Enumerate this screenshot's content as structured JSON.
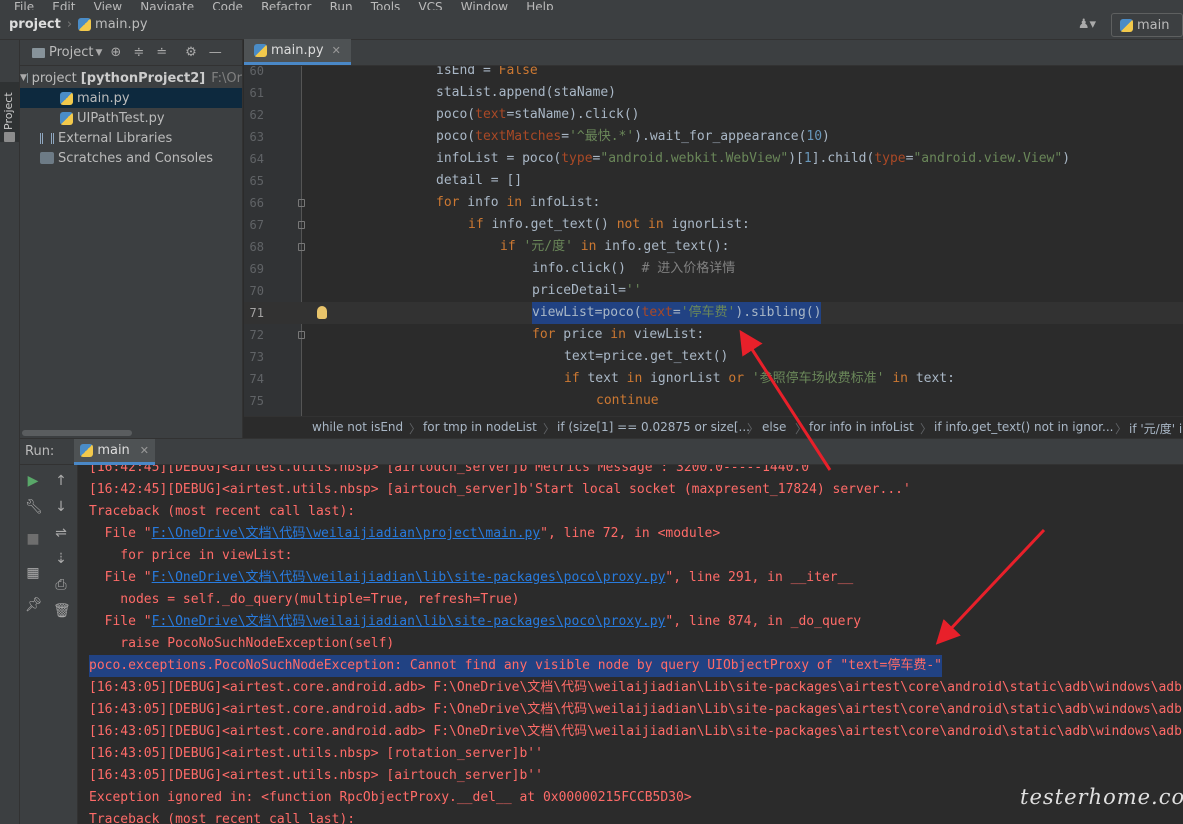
{
  "menu": {
    "items": [
      "File",
      "Edit",
      "View",
      "Navigate",
      "Code",
      "Refactor",
      "Run",
      "Tools",
      "VCS",
      "Window",
      "Help"
    ]
  },
  "navbar": {
    "project": "project",
    "file": "main.py",
    "branch": "main"
  },
  "project_panel": {
    "title": "Project",
    "tree": [
      {
        "label": "project",
        "bold_suffix": "[pythonProject2]",
        "path": "F:\\Or"
      },
      {
        "label": "main.py"
      },
      {
        "label": "UIPathTest.py"
      },
      {
        "label": "External Libraries"
      },
      {
        "label": "Scratches and Consoles"
      }
    ]
  },
  "vertical_tab": "Project",
  "editor": {
    "tab": "main.py",
    "line_numbers": [
      "60",
      "61",
      "62",
      "63",
      "64",
      "65",
      "66",
      "67",
      "68",
      "69",
      "70",
      "71",
      "72",
      "73",
      "74",
      "75"
    ],
    "current_line": "71",
    "breadcrumbs": [
      "while not isEnd",
      "for tmp in nodeList",
      "if (size[1] == 0.02875 or size[...",
      "else",
      "for info in infoList",
      "if info.get_text() not in ignor...",
      "if '元/度' i"
    ]
  },
  "run": {
    "label": "Run:",
    "tab": "main",
    "console_lines": [
      "[16:42:45][DEBUG]<airtest.utils.nbsp> [airtouch_server]b'Metrics Message : 3200.0-----1440.0'",
      "[16:42:45][DEBUG]<airtest.utils.nbsp> [airtouch_server]b'Start local socket (maxpresent_17824) server...'",
      "Traceback (most recent call last):",
      "  File \"",
      "    for price in viewList:",
      "  File \"",
      "    nodes = self._do_query(multiple=True, refresh=True)",
      "  File \"",
      "    raise PocoNoSuchNodeException(self)",
      "poco.exceptions.PocoNoSuchNodeException: Cannot find any visible node by query UIObjectProxy of \"text=停车费-\"",
      "[16:43:05][DEBUG]<airtest.core.android.adb> F:\\OneDrive\\文档\\代码\\weilaijiadian\\Lib\\site-packages\\airtest\\core\\android\\static\\adb\\windows\\adb",
      "[16:43:05][DEBUG]<airtest.core.android.adb> F:\\OneDrive\\文档\\代码\\weilaijiadian\\Lib\\site-packages\\airtest\\core\\android\\static\\adb\\windows\\adb",
      "[16:43:05][DEBUG]<airtest.core.android.adb> F:\\OneDrive\\文档\\代码\\weilaijiadian\\Lib\\site-packages\\airtest\\core\\android\\static\\adb\\windows\\adb",
      "[16:43:05][DEBUG]<airtest.utils.nbsp> [rotation_server]b''",
      "[16:43:05][DEBUG]<airtest.utils.nbsp> [airtouch_server]b''",
      "Exception ignored in: <function RpcObjectProxy.__del__ at 0x00000215FCCB5D30>",
      "Traceback (most recent call last):"
    ],
    "file_links": [
      {
        "path": "F:\\OneDrive\\文档\\代码\\weilaijiadian\\project\\main.py",
        "suffix": "\", line 72, in <module>"
      },
      {
        "path": "F:\\OneDrive\\文档\\代码\\weilaijiadian\\lib\\site-packages\\poco\\proxy.py",
        "suffix": "\", line 291, in __iter__"
      },
      {
        "path": "F:\\OneDrive\\文档\\代码\\weilaijiadian\\lib\\site-packages\\poco\\proxy.py",
        "suffix": "\", line 874, in _do_query"
      }
    ]
  },
  "watermark": "testerhome.com",
  "colors": {
    "arrow": "#e8202a",
    "selection": "#214283",
    "error_text": "#ff6b68",
    "link": "#287bde",
    "keyword": "#cc7832",
    "string": "#6a8759"
  }
}
